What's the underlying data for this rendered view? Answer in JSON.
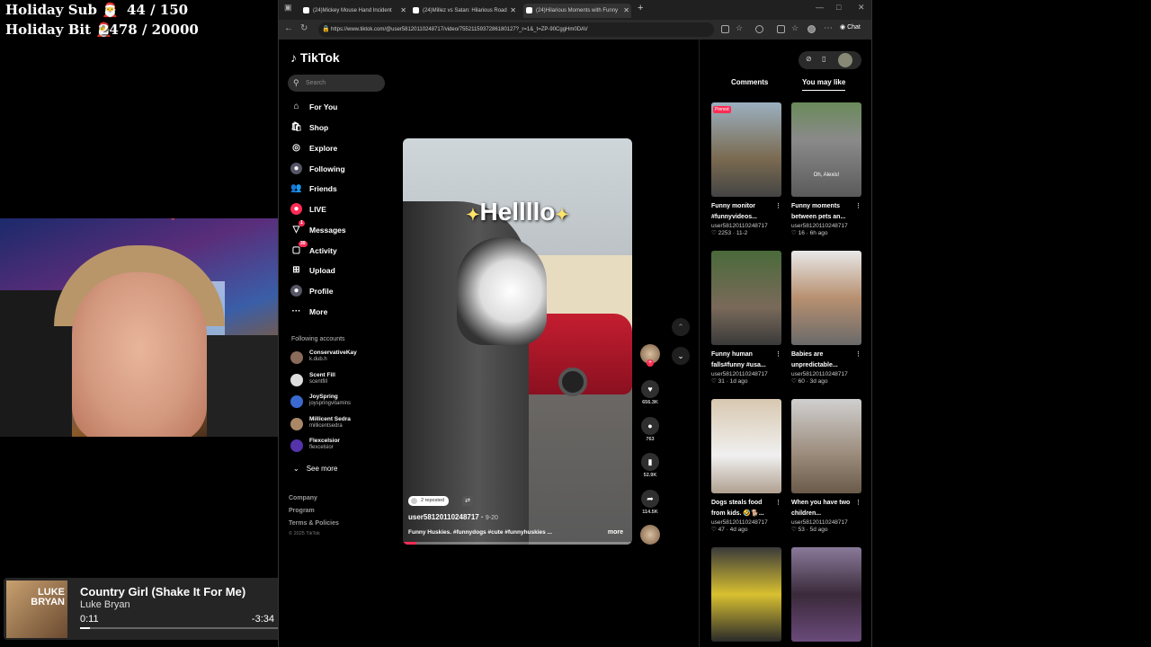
{
  "overlay": {
    "goals": [
      {
        "label": "Holiday Sub",
        "icon": "🎅",
        "value": "44 / 150"
      },
      {
        "label": "Holiday Bit",
        "icon": "🎅",
        "value": "2478 / 20000"
      }
    ],
    "now_playing": {
      "art_text": "LUKE BRYAN",
      "title": "Country Girl (Shake It For Me)",
      "artist": "Luke Bryan",
      "elapsed": "0:11",
      "remaining": "-3:34",
      "progress": 0.05
    }
  },
  "browser": {
    "tabs": [
      {
        "title": "(24)Mickey Mouse Hand Incident"
      },
      {
        "title": "(24)Millez vs Satan: Hilarious Road"
      },
      {
        "title": "(24)Hilarious Moments with Funny"
      }
    ],
    "new_tab": "+",
    "url": "https://www.tiktok.com/@user581201102487​17/video/7552115937286180127?_r=1&_t=ZP-90CggHm0DAV",
    "chat_label": "Chat"
  },
  "tiktok": {
    "logo": "TikTok",
    "search_placeholder": "Search",
    "nav": [
      {
        "label": "For You",
        "icon": "⌂"
      },
      {
        "label": "Shop",
        "icon": "🛍"
      },
      {
        "label": "Explore",
        "icon": "◎"
      },
      {
        "label": "Following",
        "icon": "●"
      },
      {
        "label": "Friends",
        "icon": "👥"
      },
      {
        "label": "LIVE",
        "icon": "●"
      },
      {
        "label": "Messages",
        "icon": "▽",
        "badge": "1"
      },
      {
        "label": "Activity",
        "icon": "▢",
        "badge": "39"
      },
      {
        "label": "Upload",
        "icon": "⊞"
      },
      {
        "label": "Profile",
        "icon": "●"
      },
      {
        "label": "More",
        "icon": "···"
      }
    ],
    "following_title": "Following accounts",
    "following": [
      {
        "name": "ConservativeKay",
        "handle": "k.dub.h",
        "color": "#8a6a5a"
      },
      {
        "name": "Scent Fill",
        "handle": "scentfill",
        "color": "#ddd"
      },
      {
        "name": "JoySpring",
        "handle": "joyspringvitamins",
        "color": "#3a6ad0"
      },
      {
        "name": "Millicent Sedra",
        "handle": "millicentsedra",
        "color": "#aa8866"
      },
      {
        "name": "Flexcelsior",
        "handle": "flexcelsior",
        "color": "#5533aa"
      }
    ],
    "see_more": "See more",
    "footer": [
      "Company",
      "Program",
      "Terms & Policies"
    ],
    "copyright": "© 2025 TikTok"
  },
  "video": {
    "caption": "Hellllo",
    "repost_label": "2 reposted",
    "username": "user58120110248717",
    "date": "9-20",
    "description": "Funny Huskies. #funnydogs #cute #funnyhuskies ...",
    "more": "more",
    "likes": "656.3K",
    "comments": "763",
    "saves": "52.9K",
    "shares": "114.5K",
    "progress": 0.06
  },
  "right": {
    "tabs": [
      {
        "label": "Comments"
      },
      {
        "label": "You may like"
      }
    ],
    "cards": [
      {
        "title": "Funny monitor #funnyvideos...",
        "user": "user58120110248717",
        "meta": "♡ 2253 · 11-2",
        "pinned": "Pinned",
        "overlay": "",
        "bg": "linear-gradient(180deg,#9bb0c0,#7a6a50 60%,#444)"
      },
      {
        "title": "Funny moments between pets an...",
        "user": "user58120110248717",
        "meta": "♡ 16 · 6h ago",
        "pinned": "",
        "overlay": "Oh, Alexis!",
        "bg": "linear-gradient(180deg,#6a8a5a,#8a8a8a 40%,#5a5a5a)"
      },
      {
        "title": "Funny human falls#funny #usa...",
        "user": "user58120110248717",
        "meta": "♡ 31 · 1d ago",
        "pinned": "",
        "overlay": "",
        "bg": "linear-gradient(180deg,#4a6a3a,#7a6a5a 60%,#3a3a3a)"
      },
      {
        "title": "Babies are unpredictable...",
        "user": "user58120110248717",
        "meta": "♡ 60 · 3d ago",
        "pinned": "",
        "overlay": "",
        "bg": "linear-gradient(180deg,#e8e8e8,#b89070 50%,#6a6a6a)"
      },
      {
        "title": "Dogs steals food from kids. 🤣🐕...",
        "user": "user58120110248717",
        "meta": "♡ 47 · 4d ago",
        "pinned": "",
        "overlay": "",
        "bg": "linear-gradient(180deg,#d8c8b0,#f0f0f0 60%,#b0a090)"
      },
      {
        "title": "When you have two children...",
        "user": "user58120110248717",
        "meta": "♡ 53 · 5d ago",
        "pinned": "",
        "overlay": "",
        "bg": "linear-gradient(180deg,#d0d0d0,#9a8a7a 60%,#6a5a4a)"
      },
      {
        "title": "",
        "user": "",
        "meta": "",
        "pinned": "",
        "overlay": "",
        "bg": "linear-gradient(180deg,#3a3a3a,#d8c030 50%,#2a2a2a)"
      },
      {
        "title": "",
        "user": "",
        "meta": "",
        "pinned": "",
        "overlay": "",
        "bg": "linear-gradient(180deg,#8a7a9a,#3a2a3a 50%,#6a4a7a)"
      }
    ]
  }
}
